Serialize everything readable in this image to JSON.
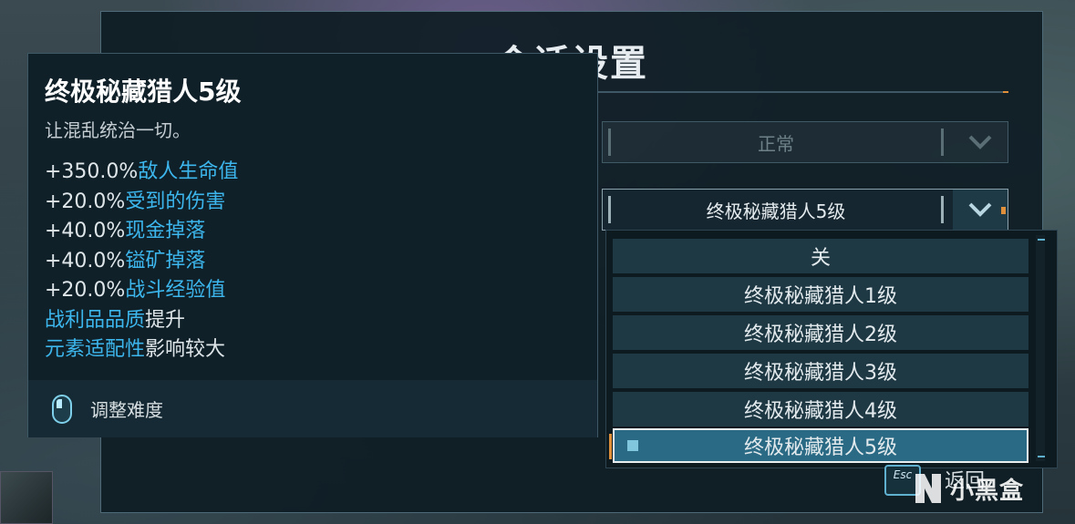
{
  "settings": {
    "title": "会话设置",
    "row1_value": "正常",
    "row2_value": "终极秘藏猎人5级"
  },
  "dropdown": {
    "items": [
      {
        "label": "关"
      },
      {
        "label": "终极秘藏猎人1级"
      },
      {
        "label": "终极秘藏猎人2级"
      },
      {
        "label": "终极秘藏猎人3级"
      },
      {
        "label": "终极秘藏猎人4级"
      },
      {
        "label": "终极秘藏猎人5级"
      }
    ],
    "selected_index": 5
  },
  "tooltip": {
    "title": "终极秘藏猎人5级",
    "subtitle": "让混乱统治一切。",
    "lines": [
      {
        "num": "+350.0%",
        "key": "敌人生命值",
        "rest": ""
      },
      {
        "num": "+20.0%",
        "key": "受到的伤害",
        "rest": ""
      },
      {
        "num": "+40.0%",
        "key": "现金掉落",
        "rest": ""
      },
      {
        "num": "+40.0%",
        "key": "镒矿掉落",
        "rest": ""
      },
      {
        "num": "+20.0%",
        "key": "战斗经验值",
        "rest": ""
      },
      {
        "num": "",
        "key": "战利品品质",
        "rest": "提升"
      },
      {
        "num": "",
        "key": "元素适配性",
        "rest": "影响较大"
      }
    ],
    "footer_label": "调整难度"
  },
  "footer": {
    "esc_key": "Esc",
    "back_label": "返回"
  },
  "watermark": {
    "text": "小黑盒"
  },
  "colors": {
    "accent_blue": "#3cb6ec",
    "accent_orange": "#e0903a",
    "selected_item": "#2a6a84"
  }
}
